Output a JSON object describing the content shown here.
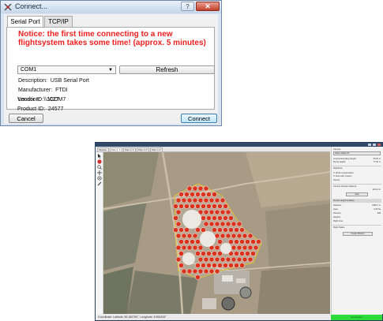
{
  "dialog": {
    "title": "Connect...",
    "help_label": "?",
    "close_label": "✕",
    "tabs": [
      "Serial Port",
      "TCP/IP"
    ],
    "notice": "Notice: the first time connecting to a new flightsystem takes some time! (approx. 5 minutes)",
    "port_value": "COM1",
    "dropdown_arrow": "▼",
    "refresh_label": "Refresh",
    "info": [
      {
        "label": "Description:",
        "value": "USB Serial Port"
      },
      {
        "label": "Manufacturer:",
        "value": "FTDI"
      },
      {
        "label": "Location:",
        "value": "\\\\.\\COM7"
      },
      {
        "label": "Vendor ID:",
        "value": "1027"
      },
      {
        "label": "Product ID:",
        "value": "24577"
      }
    ],
    "cancel_label": "Cancel",
    "connect_label": "Connect",
    "notice_color": "#ef1f1f"
  },
  "app": {
    "tabs": [
      "Mission",
      "Plan 1 ✕",
      "Plan 2 ✕",
      "Plan 3 ✕",
      "Plan 4 ✕"
    ],
    "status_text": "Coordinate: Latitude: 50.180780°, Longitude: 8.554326°",
    "sidebar": {
      "selector": "Sabre Adikan B...",
      "labels": [
        {
          "label": "Ground-Sampling Height:",
          "value": "65.00 m"
        },
        {
          "label": "Flying Height:",
          "value": "77.00 m"
        }
      ],
      "section_flight": "Flightlines",
      "check1": "Wind compensation",
      "check2": "Auto-start mission",
      "section_sensor": "Sensor",
      "camera_label": "Camera Sample Distance",
      "camera_value": "10.40 cm",
      "start_label": "Start",
      "section_terrain": "Terrain Height & Status",
      "rows": [
        {
          "label": "Distance:",
          "value": "1582.1 m"
        },
        {
          "label": "Area:",
          "value": "6.45 ha"
        },
        {
          "label": "Pictures:",
          "value": "209"
        },
        {
          "label": "Heights:",
          "value": ""
        },
        {
          "label": "Flight time:",
          "value": ""
        }
      ],
      "section_flight2": "Flight Status",
      "create_label": "Create Mission"
    },
    "connection_status": "Connected"
  }
}
